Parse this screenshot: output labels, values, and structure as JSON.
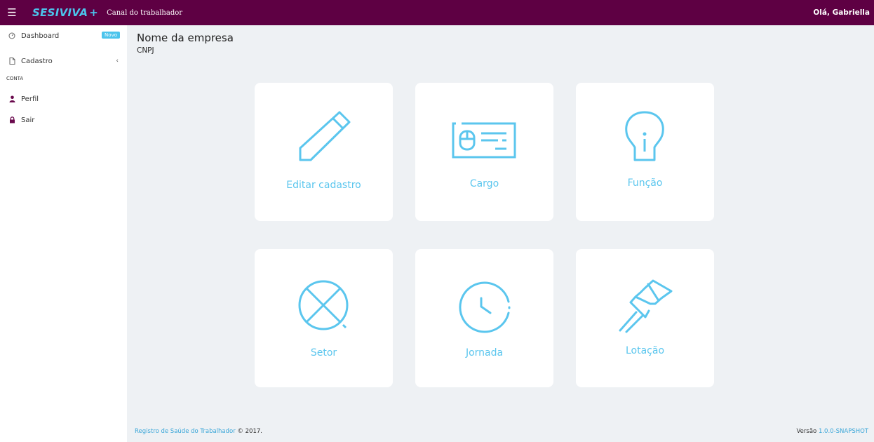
{
  "topbar": {
    "menu_icon": "hamburger-icon",
    "logo_part1": "SESI",
    "logo_part2": "VIVA",
    "logo_plus": "+",
    "subtitle": "Canal do trabalhador",
    "greeting": "Olá, Gabriella"
  },
  "sidebar": {
    "dashboard": {
      "label": "Dashboard",
      "icon": "gauge-icon",
      "badge": "Novo"
    },
    "cadastro": {
      "label": "Cadastro",
      "icon": "document-icon",
      "chevron": "‹"
    },
    "section_header": "CONTA",
    "perfil": {
      "label": "Perfil",
      "icon": "user-icon"
    },
    "sair": {
      "label": "Sair",
      "icon": "lock-icon"
    }
  },
  "main": {
    "company_name": "Nome da empresa",
    "cnpj": "CNPJ",
    "cards": [
      {
        "label": "Editar cadastro",
        "icon": "pencil-icon"
      },
      {
        "label": "Cargo",
        "icon": "id-card-icon"
      },
      {
        "label": "Função",
        "icon": "lightbulb-icon"
      },
      {
        "label": "Setor",
        "icon": "crossed-circle-icon"
      },
      {
        "label": "Jornada",
        "icon": "clock-icon"
      },
      {
        "label": "Lotação",
        "icon": "pushpin-icon"
      }
    ]
  },
  "footer": {
    "link_text": "Registro de Saúde do Trabalhador",
    "copyright": " © 2017.",
    "version_label": "Versão ",
    "version_value": "1.0.0-SNAPSHOT"
  },
  "colors": {
    "topbar": "#5e0043",
    "accent": "#4cc4ec",
    "icon_stroke": "#5bc6ee",
    "background": "#eef1f4"
  }
}
